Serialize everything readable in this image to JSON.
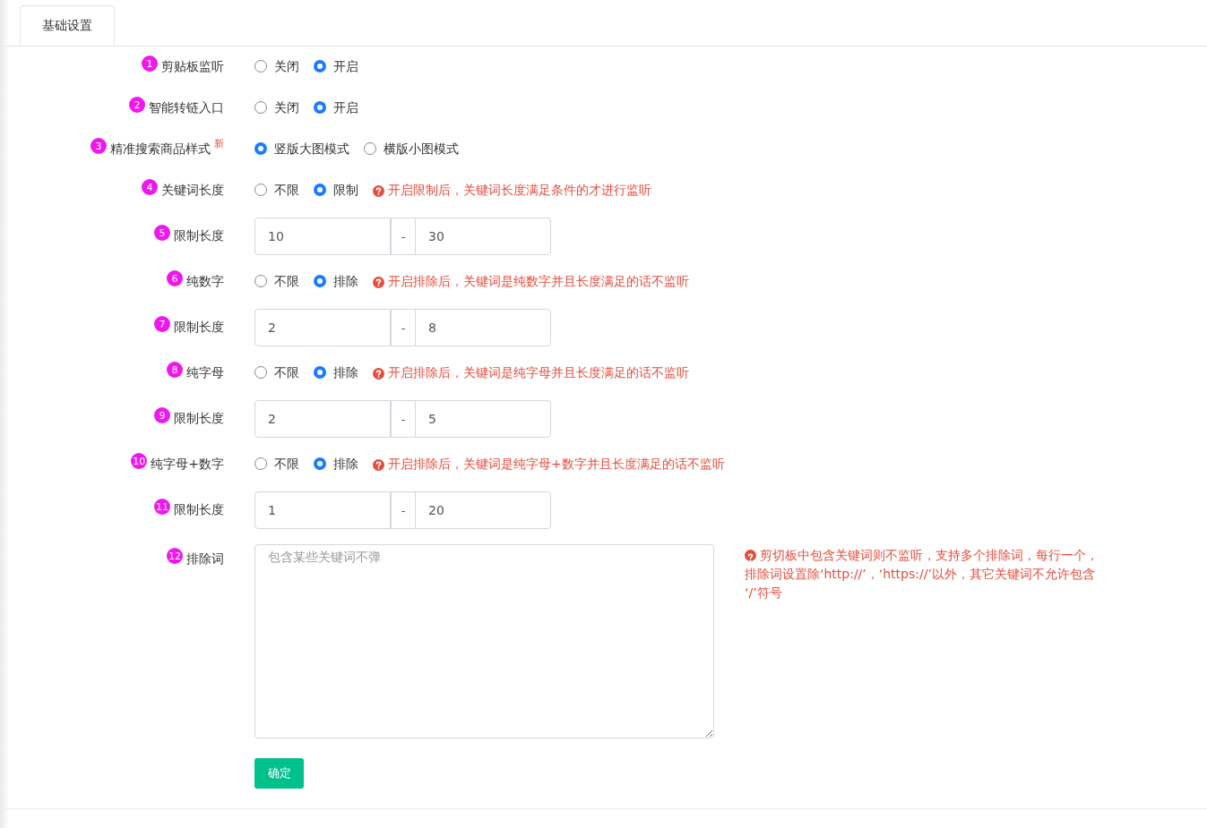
{
  "tabs": [
    {
      "label": "基础设置",
      "selected": true
    }
  ],
  "rows": [
    {
      "kind": "radio",
      "badge": "1",
      "label": "剪贴板监听",
      "options": [
        {
          "label": "关闭",
          "selected": false
        },
        {
          "label": "开启",
          "selected": true
        }
      ]
    },
    {
      "kind": "radio",
      "badge": "2",
      "label": "智能转链入口",
      "options": [
        {
          "label": "关闭",
          "selected": false
        },
        {
          "label": "开启",
          "selected": true
        }
      ]
    },
    {
      "kind": "radio",
      "badge": "3",
      "label": "精准搜索商品样式",
      "new_tag": "新",
      "options": [
        {
          "label": "竖版大图模式",
          "selected": true
        },
        {
          "label": "横版小图模式",
          "selected": false
        }
      ]
    },
    {
      "kind": "radio",
      "badge": "4",
      "label": "关键词长度",
      "options": [
        {
          "label": "不限",
          "selected": false
        },
        {
          "label": "限制",
          "selected": true
        }
      ],
      "help": "开启限制后，关键词长度满足条件的才进行监听"
    },
    {
      "kind": "range",
      "badge": "5",
      "label": "限制长度",
      "min": "10",
      "separator": "-",
      "max": "30"
    },
    {
      "kind": "radio",
      "badge": "6",
      "label": "纯数字",
      "options": [
        {
          "label": "不限",
          "selected": false
        },
        {
          "label": "排除",
          "selected": true
        }
      ],
      "help": "开启排除后，关键词是纯数字并且长度满足的话不监听"
    },
    {
      "kind": "range",
      "badge": "7",
      "label": "限制长度",
      "min": "2",
      "separator": "-",
      "max": "8"
    },
    {
      "kind": "radio",
      "badge": "8",
      "label": "纯字母",
      "options": [
        {
          "label": "不限",
          "selected": false
        },
        {
          "label": "排除",
          "selected": true
        }
      ],
      "help": "开启排除后，关键词是纯字母并且长度满足的话不监听"
    },
    {
      "kind": "range",
      "badge": "9",
      "label": "限制长度",
      "min": "2",
      "separator": "-",
      "max": "5"
    },
    {
      "kind": "radio",
      "badge": "10",
      "label": "纯字母+数字",
      "options": [
        {
          "label": "不限",
          "selected": false
        },
        {
          "label": "排除",
          "selected": true
        }
      ],
      "help": "开启排除后，关键词是纯字母+数字并且长度满足的话不监听"
    },
    {
      "kind": "range",
      "badge": "11",
      "label": "限制长度",
      "min": "1",
      "separator": "-",
      "max": "20"
    },
    {
      "kind": "textarea",
      "badge": "12",
      "label": "排除词",
      "placeholder": "包含某些关键词不弹",
      "help_lines": [
        "剪切板中包含关键词则不监听，支持多个排除词，每行一个，",
        "排除词设置除‘http://’，‘https://’以外，其它关键词不允许包含",
        "‘/’符号"
      ]
    }
  ],
  "submit": "确定"
}
